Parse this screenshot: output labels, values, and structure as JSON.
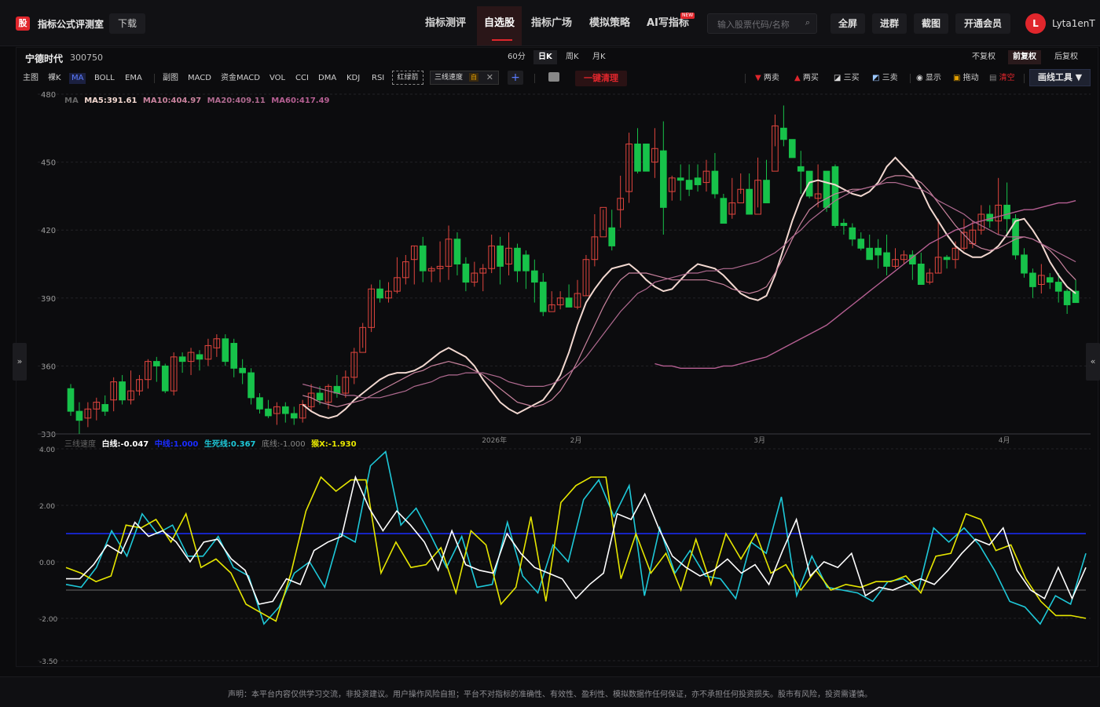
{
  "topbar": {
    "logo": "股",
    "app_name": "指标公式评测室",
    "download": "下载",
    "nav": [
      "指标测评",
      "自选股",
      "指标广场",
      "模拟策略",
      "AI写指标"
    ],
    "new_tag": "NEW",
    "search_placeholder": "输入股票代码/名称",
    "buttons": [
      "全屏",
      "进群",
      "截图",
      "开通会员"
    ],
    "avatar_initial": "L",
    "username": "Lyta1enT"
  },
  "stock": {
    "name": "宁德时代",
    "code": "300750"
  },
  "periods": [
    "60分",
    "日K",
    "周K",
    "月K"
  ],
  "active_period": "日K",
  "adjust": [
    "不复权",
    "前复权",
    "后复权"
  ],
  "active_adjust": "前复权",
  "indicators": [
    "主图",
    "裸K",
    "MA",
    "BOLL",
    "EMA",
    "副图",
    "MACD",
    "资金MACD",
    "VOL",
    "CCI",
    "DMA",
    "KDJ",
    "RSI"
  ],
  "red_green_arrow": "红绿箭",
  "speed_tag": {
    "label": "三线速度",
    "self": "自"
  },
  "clear_button": "一键清理",
  "right_tools": [
    "两卖",
    "两买",
    "三买",
    "三卖",
    "显示",
    "拖动",
    "清空"
  ],
  "draw_tools": "画线工具 ▼",
  "side_left": "»",
  "side_right": "«",
  "ma_legend": {
    "prefix": "MA",
    "ma5": "MA5:391.61",
    "ma10": "MA10:404.97",
    "ma20": "MA20:409.11",
    "ma60": "MA60:417.49"
  },
  "sub_legend": {
    "name": "三线速度",
    "white": "白线:-0.047",
    "mid": "中线:1.000",
    "life": "生死线:0.367",
    "bottom": "底线:-1.000",
    "monkey": "猴X:-1.930"
  },
  "colors": {
    "up": "#e0453e",
    "down": "#17c24a",
    "accent": "#e0262c",
    "ma5": "#f2d8d0",
    "ma10": "#c9839e",
    "ma20": "#b06a90",
    "ma60": "#b55f92",
    "white_line": "#ffffff",
    "life_line": "#1ec8d8",
    "monkey_line": "#e6e600",
    "mid_line": "#1a2cff"
  },
  "chart_data": {
    "type": "candlestick",
    "y_ticks": [
      "480",
      "450",
      "420",
      "390",
      "360",
      "330"
    ],
    "ylim": [
      330,
      480
    ],
    "x_labels": [
      "2026年",
      "2月",
      "3月",
      "4月"
    ],
    "candles": [
      [
        350,
        340,
        352,
        338
      ],
      [
        340,
        336,
        344,
        330
      ],
      [
        337,
        341,
        344,
        333
      ],
      [
        341,
        344,
        346,
        336
      ],
      [
        343,
        340,
        347,
        338
      ],
      [
        345,
        353,
        355,
        340
      ],
      [
        353,
        345,
        356,
        343
      ],
      [
        345,
        349,
        358,
        343
      ],
      [
        349,
        354,
        356,
        347
      ],
      [
        354,
        362,
        363,
        350
      ],
      [
        362,
        360,
        364,
        353
      ],
      [
        360,
        349,
        361,
        348
      ],
      [
        349,
        364,
        366,
        347
      ],
      [
        364,
        362,
        366,
        357
      ],
      [
        362,
        366,
        368,
        356
      ],
      [
        365,
        363,
        367,
        358
      ],
      [
        363,
        369,
        372,
        360
      ],
      [
        368,
        372,
        374,
        364
      ],
      [
        372,
        362,
        374,
        360
      ],
      [
        370,
        359,
        372,
        355
      ],
      [
        359,
        357,
        363,
        352
      ],
      [
        357,
        346,
        359,
        343
      ],
      [
        346,
        341,
        348,
        339
      ],
      [
        341,
        338,
        345,
        337
      ],
      [
        339,
        342,
        344,
        334
      ],
      [
        342,
        339,
        344,
        335
      ],
      [
        339,
        337,
        342,
        334
      ],
      [
        337,
        343,
        345,
        335
      ],
      [
        342,
        348,
        352,
        340
      ],
      [
        348,
        345,
        351,
        343
      ],
      [
        344,
        351,
        352,
        341
      ],
      [
        351,
        348,
        356,
        346
      ],
      [
        348,
        355,
        358,
        346
      ],
      [
        355,
        366,
        368,
        352
      ],
      [
        366,
        377,
        379,
        368
      ],
      [
        377,
        394,
        396,
        375
      ],
      [
        394,
        390,
        398,
        388
      ],
      [
        390,
        393,
        397,
        388
      ],
      [
        393,
        399,
        408,
        392
      ],
      [
        399,
        406,
        409,
        396
      ],
      [
        407,
        413,
        413,
        396
      ],
      [
        413,
        402,
        417,
        397
      ],
      [
        402,
        403,
        404,
        397
      ],
      [
        403,
        404,
        415,
        397
      ],
      [
        404,
        416,
        422,
        398
      ],
      [
        416,
        405,
        419,
        400
      ],
      [
        405,
        397,
        408,
        393
      ],
      [
        397,
        401,
        406,
        395
      ],
      [
        401,
        403,
        405,
        393
      ],
      [
        403,
        413,
        418,
        401
      ],
      [
        413,
        404,
        417,
        396
      ],
      [
        405,
        412,
        419,
        400
      ],
      [
        412,
        402,
        414,
        397
      ],
      [
        409,
        402,
        411,
        394
      ],
      [
        402,
        397,
        407,
        388
      ],
      [
        397,
        384,
        401,
        382
      ],
      [
        384,
        387,
        393,
        385
      ],
      [
        387,
        390,
        393,
        385
      ],
      [
        390,
        386,
        396,
        386
      ],
      [
        386,
        392,
        398,
        385
      ],
      [
        391,
        407,
        409,
        391
      ],
      [
        407,
        417,
        427,
        404
      ],
      [
        417,
        430,
        429,
        420
      ],
      [
        421,
        413,
        429,
        411
      ],
      [
        429,
        434,
        444,
        421
      ],
      [
        437,
        458,
        463,
        432
      ],
      [
        458,
        446,
        465,
        445
      ],
      [
        458,
        446,
        458,
        452
      ],
      [
        450,
        456,
        465,
        443
      ],
      [
        455,
        430,
        468,
        418
      ],
      [
        437,
        443,
        444,
        433
      ],
      [
        443,
        442,
        449,
        433
      ],
      [
        442,
        438,
        449,
        435
      ],
      [
        443,
        440,
        449,
        437
      ],
      [
        441,
        446,
        451,
        437
      ],
      [
        446,
        436,
        454,
        434
      ],
      [
        434,
        423,
        436,
        428
      ],
      [
        427,
        432,
        443,
        425
      ],
      [
        432,
        438,
        445,
        436
      ],
      [
        438,
        427,
        445,
        430
      ],
      [
        427,
        442,
        452,
        430
      ],
      [
        442,
        432,
        451,
        432
      ],
      [
        446,
        466,
        471,
        457
      ],
      [
        465,
        460,
        475,
        457
      ],
      [
        460,
        452,
        458,
        456
      ],
      [
        448,
        446,
        455,
        436
      ],
      [
        446,
        435,
        446,
        434
      ],
      [
        434,
        436,
        449,
        430
      ],
      [
        446,
        430,
        439,
        428
      ],
      [
        448,
        422,
        449,
        421
      ],
      [
        423,
        422,
        425,
        418
      ],
      [
        421,
        416,
        423,
        413
      ],
      [
        416,
        412,
        419,
        411
      ],
      [
        412,
        407,
        418,
        407
      ],
      [
        412,
        409,
        416,
        403
      ],
      [
        410,
        404,
        418,
        400
      ],
      [
        404,
        407,
        412,
        403
      ],
      [
        407,
        409,
        411,
        405
      ],
      [
        409,
        405,
        411,
        398
      ],
      [
        405,
        396,
        410,
        399
      ],
      [
        397,
        401,
        403,
        396
      ],
      [
        401,
        408,
        425,
        401
      ],
      [
        408,
        407,
        409,
        403
      ],
      [
        407,
        412,
        415,
        403
      ],
      [
        412,
        419,
        425,
        411
      ],
      [
        414,
        420,
        424,
        412
      ],
      [
        420,
        427,
        431,
        418
      ],
      [
        427,
        424,
        431,
        421
      ],
      [
        424,
        431,
        443,
        418
      ],
      [
        431,
        425,
        441,
        417
      ],
      [
        425,
        409,
        427,
        407
      ],
      [
        409,
        401,
        412,
        399
      ],
      [
        401,
        395,
        403,
        390
      ],
      [
        396,
        400,
        405,
        392
      ],
      [
        399,
        397,
        401,
        394
      ],
      [
        397,
        393,
        401,
        388
      ],
      [
        393,
        387,
        394,
        383
      ],
      [
        393,
        388,
        398,
        391
      ]
    ],
    "ma_series": {
      "ma5": [
        343,
        340,
        338,
        337,
        338,
        341,
        345,
        348,
        351,
        354,
        356,
        357,
        357,
        358,
        360,
        363,
        366,
        368,
        366,
        364,
        360,
        354,
        349,
        344,
        341,
        339,
        341,
        343,
        345,
        350,
        356,
        366,
        378,
        388,
        394,
        399,
        403,
        404,
        405,
        402,
        398,
        395,
        393,
        394,
        398,
        402,
        405,
        404,
        403,
        400,
        396,
        392,
        390,
        389,
        391,
        400,
        412,
        424,
        434,
        441,
        442,
        441,
        440,
        438,
        436,
        435,
        437,
        441,
        448,
        452,
        448,
        444,
        438,
        430,
        424,
        418,
        413,
        410,
        408,
        408,
        410,
        413,
        418,
        424,
        425,
        420,
        414,
        406,
        400,
        395,
        392
      ],
      "ma10": [
        347,
        346,
        344,
        343,
        342,
        343,
        344,
        345,
        347,
        349,
        351,
        353,
        355,
        357,
        358,
        360,
        361,
        362,
        361,
        360,
        358,
        356,
        353,
        350,
        347,
        344,
        343,
        342,
        343,
        345,
        349,
        355,
        362,
        370,
        378,
        386,
        393,
        398,
        401,
        401,
        401,
        400,
        399,
        398,
        398,
        398,
        398,
        398,
        397,
        396,
        394,
        393,
        392,
        393,
        395,
        401,
        408,
        416,
        423,
        429,
        432,
        434,
        436,
        437,
        438,
        438,
        439,
        440,
        443,
        444,
        444,
        443,
        441,
        437,
        432,
        427,
        422,
        418,
        414,
        412,
        411,
        412,
        414,
        416,
        417,
        416,
        414,
        411,
        407,
        402,
        398
      ],
      "ma20": [
        352,
        351,
        350,
        349,
        348,
        347,
        347,
        346,
        346,
        346,
        347,
        348,
        349,
        351,
        352,
        353,
        355,
        356,
        356,
        357,
        357,
        357,
        356,
        355,
        353,
        352,
        351,
        351,
        351,
        352,
        354,
        357,
        360,
        364,
        369,
        374,
        379,
        384,
        388,
        392,
        394,
        397,
        398,
        399,
        400,
        401,
        401,
        402,
        402,
        403,
        403,
        404,
        405,
        406,
        408,
        410,
        413,
        417,
        420,
        424,
        427,
        430,
        433,
        435,
        437,
        438,
        439,
        440,
        441,
        441,
        440,
        439,
        438,
        436,
        433,
        431,
        429,
        427,
        424,
        422,
        420,
        418,
        417,
        417,
        417,
        416,
        414,
        412,
        410,
        408,
        406
      ],
      "ma60": [
        361,
        360,
        360,
        359,
        359,
        359,
        359,
        359,
        360,
        360,
        361,
        362,
        363,
        364,
        366,
        368,
        370,
        372,
        374,
        376,
        378,
        381,
        384,
        387,
        390,
        393,
        396,
        399,
        402,
        405,
        408,
        411,
        414,
        416,
        418,
        420,
        421,
        423,
        424,
        425,
        426,
        427,
        428,
        429,
        429,
        430,
        431,
        432,
        432,
        433
      ]
    },
    "sub": {
      "ylim": [
        -3.5,
        4.0
      ],
      "y_ticks": [
        "4.00",
        "2.00",
        "0.00",
        "-2.00",
        "-3.50"
      ],
      "mid": 1.0,
      "bottom": -1.0,
      "white": [
        -0.6,
        -0.6,
        -0.1,
        0.6,
        0.3,
        1.4,
        0.9,
        1.1,
        0.7,
        0.0,
        0.7,
        0.8,
        0.1,
        -0.3,
        -1.5,
        -1.4,
        -0.6,
        -0.8,
        0.4,
        0.7,
        0.9,
        3.0,
        1.9,
        1.1,
        1.8,
        1.3,
        0.7,
        -0.3,
        1.1,
        -0.1,
        -0.3,
        -0.4,
        1.0,
        0.3,
        -0.2,
        -0.4,
        -0.6,
        -1.3,
        -0.8,
        -0.4,
        1.7,
        1.5,
        2.4,
        1.2,
        0.2,
        -0.2,
        -0.5,
        -0.3,
        0.1,
        -0.4,
        -0.1,
        -0.8,
        0.4,
        1.5,
        -0.5,
        0.0,
        -0.2,
        0.3,
        -1.2,
        -0.9,
        -1.0,
        -0.8,
        -0.6,
        -0.8,
        -0.3,
        0.3,
        0.8,
        0.6,
        1.2,
        -0.3,
        -1.0,
        -1.3,
        -0.2,
        -1.3,
        -0.2
      ],
      "life": [
        -0.8,
        -0.9,
        -0.2,
        1.1,
        0.2,
        1.7,
        1.0,
        1.3,
        0.2,
        0.2,
        0.9,
        -0.2,
        -0.5,
        -2.2,
        -1.6,
        -0.4,
        0.0,
        -0.9,
        1.0,
        0.7,
        3.4,
        3.9,
        1.3,
        1.9,
        0.9,
        -0.2,
        0.9,
        -0.9,
        -0.8,
        1.4,
        -0.5,
        -1.1,
        0.6,
        0.0,
        2.2,
        2.9,
        1.6,
        2.7,
        -1.2,
        1.2,
        -0.4,
        0.4,
        -0.5,
        -0.6,
        -1.3,
        0.7,
        0.3,
        2.3,
        -1.2,
        0.2,
        -0.9,
        -1.0,
        -1.1,
        -1.4,
        -0.7,
        -0.6,
        -1.0,
        1.2,
        0.7,
        1.2,
        0.6,
        -0.3,
        -1.4,
        -1.6,
        -2.2,
        -1.2,
        -1.5,
        0.3
      ],
      "monkey": [
        -0.2,
        -0.4,
        -0.7,
        -0.5,
        1.3,
        1.2,
        1.5,
        0.7,
        1.7,
        -0.2,
        0.1,
        -0.4,
        -1.5,
        -1.8,
        -2.1,
        -0.4,
        1.8,
        3.0,
        2.5,
        2.9,
        2.9,
        -0.4,
        0.7,
        -0.2,
        -0.1,
        0.5,
        -1.1,
        1.1,
        0.6,
        -1.5,
        -0.9,
        1.6,
        -1.4,
        2.1,
        2.7,
        3.0,
        3.0,
        -0.6,
        1.0,
        -0.4,
        0.3,
        -1.0,
        0.8,
        -0.8,
        1.0,
        0.1,
        1.0,
        -0.4,
        -0.1,
        -1.0,
        -0.3,
        -1.0,
        -0.8,
        -0.9,
        -0.7,
        -0.7,
        -0.5,
        -1.1,
        0.2,
        0.3,
        1.7,
        1.5,
        0.4,
        0.6,
        -0.6,
        -1.4,
        -1.9,
        -1.9,
        -2.0
      ]
    }
  },
  "footer": "声明：本平台内容仅供学习交流，非投资建议。用户操作风险自担；平台不对指标的准确性、有效性、盈利性、模拟数据作任何保证，亦不承担任何投资损失。股市有风险，投资需谨慎。"
}
